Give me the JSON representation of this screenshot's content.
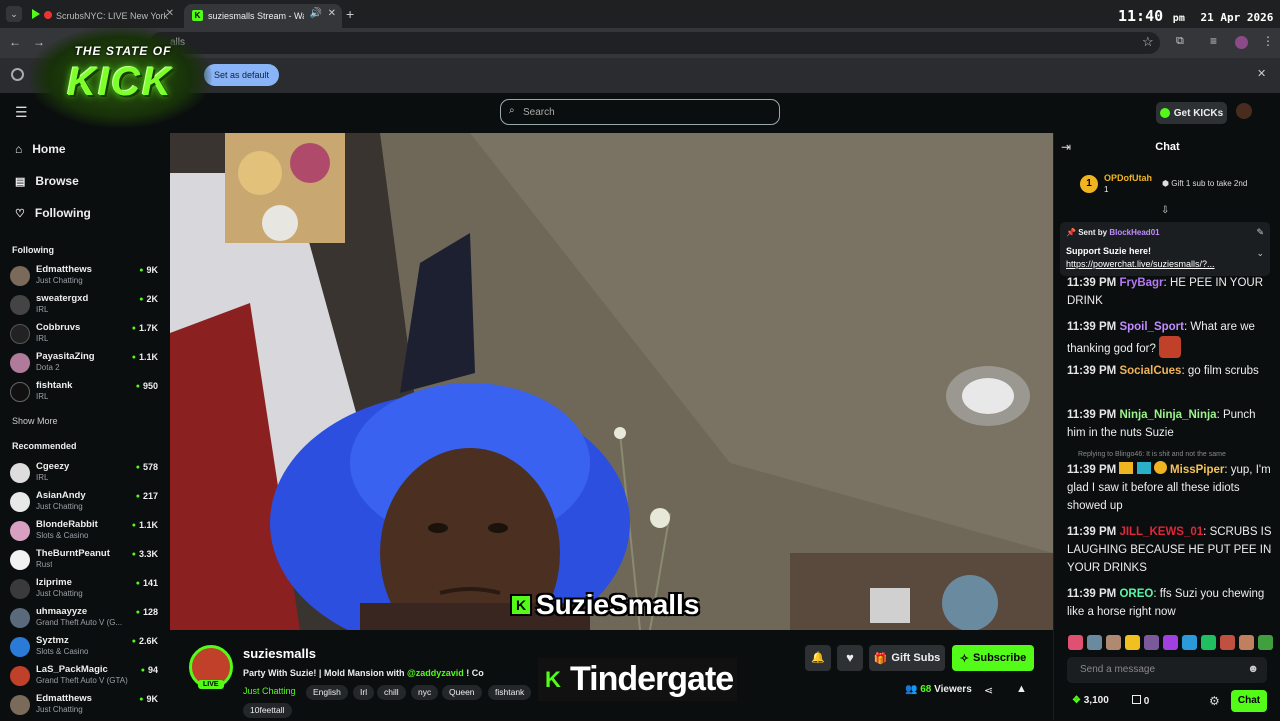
{
  "browser": {
    "tabs": [
      {
        "title": "ScrubsNYC: LIVE New York"
      },
      {
        "title": "suziesmalls Stream - Watch"
      }
    ],
    "address_fragment": "alls",
    "infobar_button": "Set as default"
  },
  "overlay": {
    "clock_time": "11:40",
    "clock_suffix": "pm",
    "clock_date": "21 Apr 2026",
    "logo_top": "THE STATE OF",
    "logo_main": "KICK",
    "name_caption": "SuzieSmalls",
    "topic_caption": "Tindergate"
  },
  "header": {
    "search_placeholder": "Search",
    "get_kicks_label": "Get KICKs"
  },
  "sidebar": {
    "nav": [
      {
        "label": "Home",
        "icon": "home-icon"
      },
      {
        "label": "Browse",
        "icon": "browse-icon"
      },
      {
        "label": "Following",
        "icon": "heart-icon"
      }
    ],
    "following_title": "Following",
    "following": [
      {
        "name": "Edmatthews",
        "category": "Just Chatting",
        "viewers": "9K"
      },
      {
        "name": "sweatergxd",
        "category": "IRL",
        "viewers": "2K"
      },
      {
        "name": "Cobbruvs",
        "category": "IRL",
        "viewers": "1.7K"
      },
      {
        "name": "PayasitaZing",
        "category": "Dota 2",
        "viewers": "1.1K"
      },
      {
        "name": "fishtank",
        "category": "IRL",
        "viewers": "950"
      }
    ],
    "show_more": "Show More",
    "recommended_title": "Recommended",
    "recommended": [
      {
        "name": "Cgeezy",
        "category": "IRL",
        "viewers": "578"
      },
      {
        "name": "AsianAndy",
        "category": "Just Chatting",
        "viewers": "217"
      },
      {
        "name": "BlondeRabbit",
        "category": "Slots & Casino",
        "viewers": "1.1K"
      },
      {
        "name": "TheBurntPeanut",
        "category": "Rust",
        "viewers": "3.3K"
      },
      {
        "name": "Iziprime",
        "category": "Just Chatting",
        "viewers": "141"
      },
      {
        "name": "uhmaayyze",
        "category": "Grand Theft Auto V (G...",
        "viewers": "128"
      },
      {
        "name": "Syztmz",
        "category": "Slots & Casino",
        "viewers": "2.6K"
      },
      {
        "name": "LaS_PackMagic",
        "category": "Grand Theft Auto V (GTA)",
        "viewers": "94"
      },
      {
        "name": "Edmatthews",
        "category": "Just Chatting",
        "viewers": "9K"
      }
    ]
  },
  "stream": {
    "streamer": "suziesmalls",
    "live_badge": "LIVE",
    "title_part1": "Party With Suzie! |",
    "title_part2": "Mold Mansion with",
    "title_mention": "@zaddyzavid",
    "title_part3": "! Co",
    "category": "Just Chatting",
    "tags": [
      "English",
      "Irl",
      "chill",
      "nyc",
      "Queen",
      "fishtank",
      "10feettall"
    ],
    "gift_subs_label": "Gift Subs",
    "subscribe_label": "Subscribe",
    "viewer_count": "68",
    "viewers_label": "Viewers"
  },
  "chat": {
    "title": "Chat",
    "top_gifter": {
      "name": "OPDofUtah",
      "rank": "1",
      "count": "1"
    },
    "gift_prompt": "Gift 1 sub to take 2nd",
    "pinned": {
      "sent_by_label": "Sent by",
      "sender": "BlockHead01",
      "text": "Support Suzie here!",
      "link": "https://powerchat.live/suziesmalls/?..."
    },
    "messages": [
      {
        "time": "11:39 PM",
        "user": "FryBagr",
        "color": "#b678f5",
        "text": "HE PEE IN YOUR DRINK"
      },
      {
        "time": "11:39 PM",
        "user": "Spoil_Sport",
        "color": "#c08cff",
        "text": "What are we thanking god for?"
      },
      {
        "time": "11:39 PM",
        "user": "SocialCues",
        "color": "#f0b45a",
        "text": "go film scrubs"
      },
      {
        "time": "11:39 PM",
        "user": "Ninja_Ninja_Ninja",
        "color": "#9cf58a",
        "text": "Punch him in the nuts Suzie"
      },
      {
        "reply": "Replying to Blingo46: It is shit and not the same",
        "time": "11:39 PM",
        "user": "MissPiper",
        "color": "#f5c45a",
        "text": "yup, I'm glad I saw it before all these idiots showed up"
      },
      {
        "time": "11:39 PM",
        "user": "JILL_KEWS_01",
        "color": "#e0263a",
        "text": "SCRUBS IS LAUGHING BECAUSE HE PUT PEE IN YOUR DRINKS"
      },
      {
        "time": "11:39 PM",
        "user": "OREO",
        "color": "#5af5a8",
        "text": "ffs Suzi you chewing like a horse right now"
      }
    ],
    "input_placeholder": "Send a message",
    "kicks_balance": "3,100",
    "points": "0",
    "chat_button": "Chat"
  },
  "colors": {
    "kick_green": "#53fc18",
    "background": "#0b0e0f",
    "wig_blue": "#2c4fe0"
  }
}
